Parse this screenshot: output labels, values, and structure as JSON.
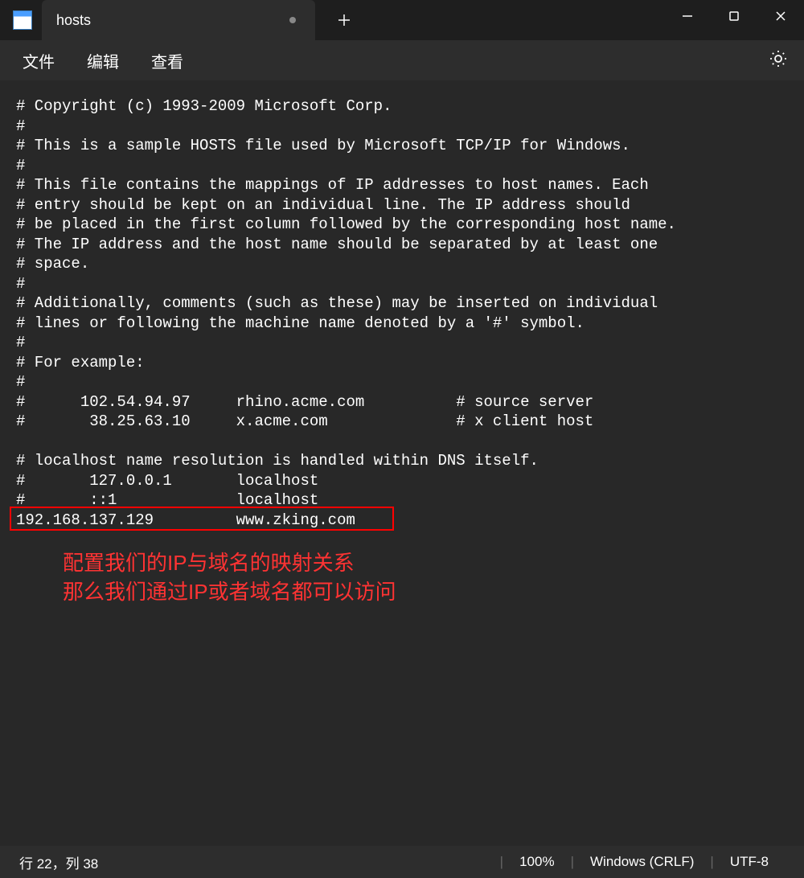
{
  "titlebar": {
    "tab_title": "hosts",
    "modified": true
  },
  "menubar": {
    "file": "文件",
    "edit": "编辑",
    "view": "查看"
  },
  "editor": {
    "content": "# Copyright (c) 1993-2009 Microsoft Corp.\n#\n# This is a sample HOSTS file used by Microsoft TCP/IP for Windows.\n#\n# This file contains the mappings of IP addresses to host names. Each\n# entry should be kept on an individual line. The IP address should\n# be placed in the first column followed by the corresponding host name.\n# The IP address and the host name should be separated by at least one\n# space.\n#\n# Additionally, comments (such as these) may be inserted on individual\n# lines or following the machine name denoted by a '#' symbol.\n#\n# For example:\n#\n#      102.54.94.97     rhino.acme.com          # source server\n#       38.25.63.10     x.acme.com              # x client host\n\n# localhost name resolution is handled within DNS itself.\n#\t127.0.0.1       localhost\n#\t::1             localhost\n192.168.137.129\t\twww.zking.com",
    "highlighted_line": "192.168.137.129\t\twww.zking.com"
  },
  "annotation": {
    "line1": "配置我们的IP与域名的映射关系",
    "line2": "那么我们通过IP或者域名都可以访问"
  },
  "statusbar": {
    "position": "行 22，列 38",
    "zoom": "100%",
    "line_ending": "Windows (CRLF)",
    "encoding": "UTF-8"
  }
}
